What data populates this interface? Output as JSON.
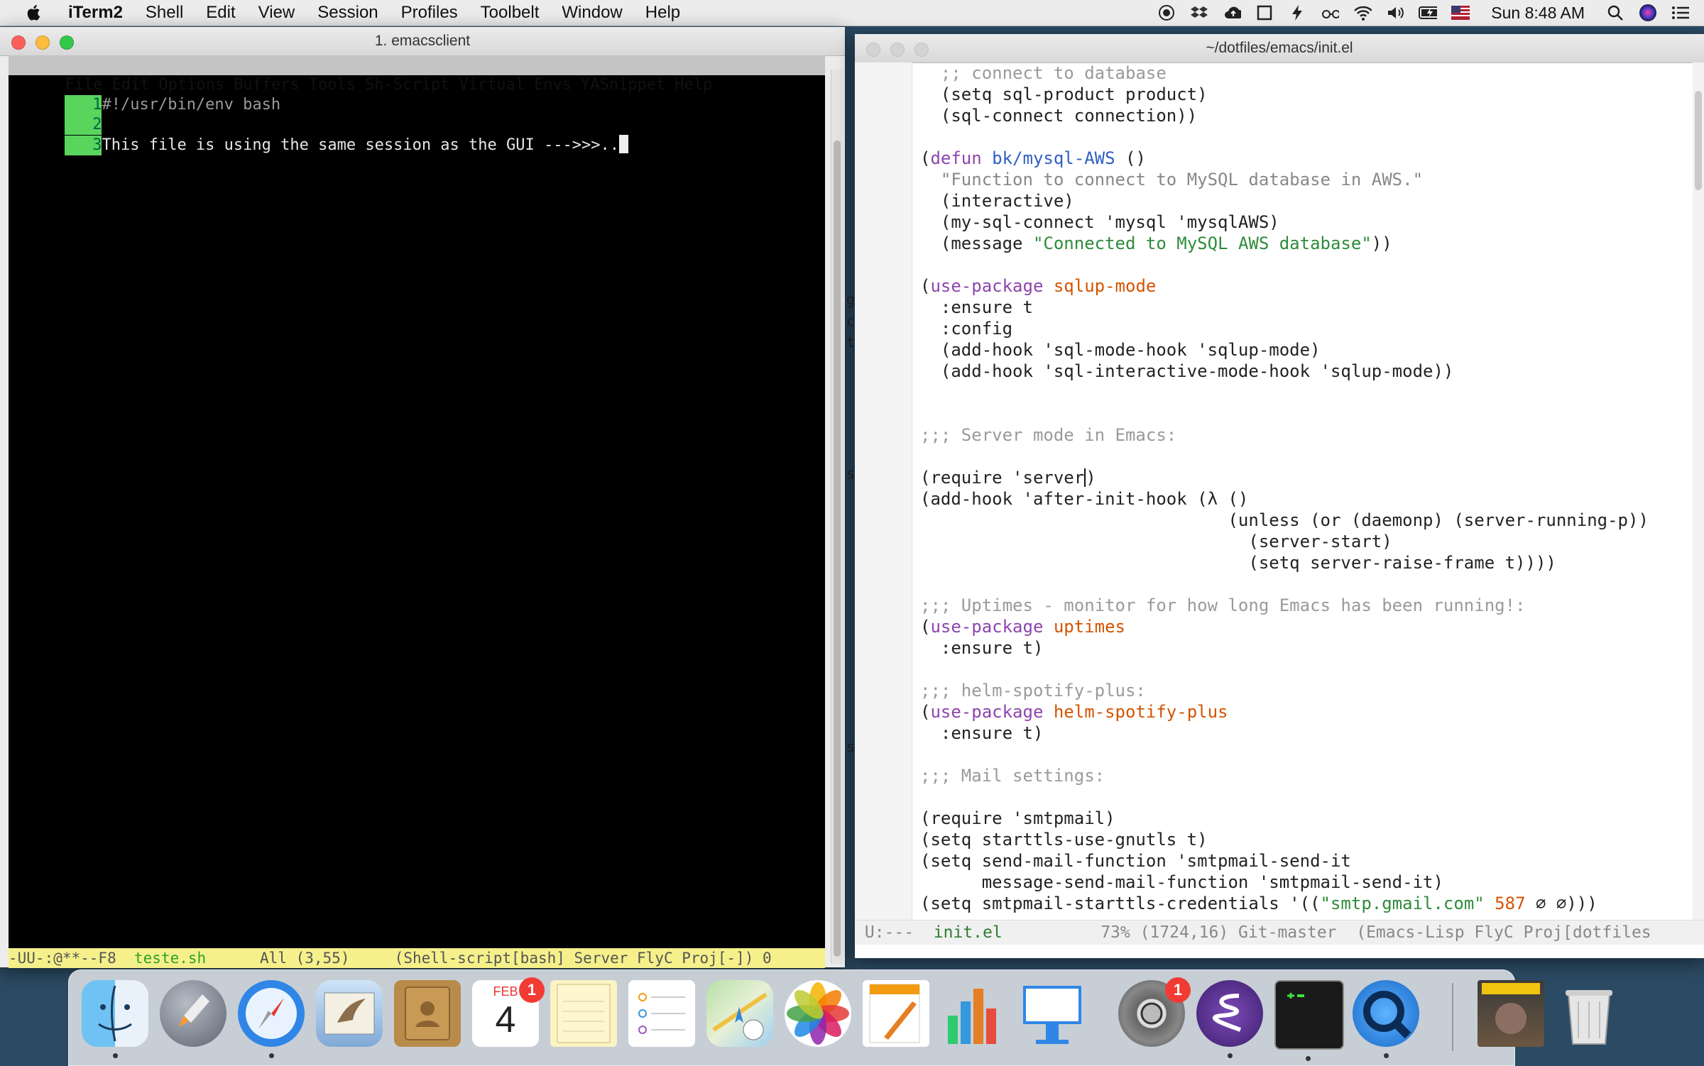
{
  "menubar": {
    "app_name": "iTerm2",
    "items": [
      "Shell",
      "Edit",
      "View",
      "Session",
      "Profiles",
      "Toolbelt",
      "Window",
      "Help"
    ],
    "clock": "Sun 8:48 AM",
    "status_icons": [
      "record-icon",
      "dropbox-icon",
      "cloud-upload-icon",
      "window-icon",
      "bolt-icon",
      "glasses-icon",
      "wifi-icon",
      "volume-icon",
      "battery-icon",
      "flag-us-icon",
      "search-icon",
      "siri-icon",
      "menu-list-icon"
    ]
  },
  "iterm": {
    "title": "1. emacsclient",
    "emacs_menu": [
      "File",
      "Edit",
      "Options",
      "Buffers",
      "Tools",
      "Sh-Script",
      "Virtual",
      "Envs",
      "YASnippet",
      "Help"
    ],
    "lines": [
      {
        "num": "1",
        "text": "#!/usr/bin/env bash"
      },
      {
        "num": "2",
        "text": ""
      },
      {
        "num": "3",
        "text": "This file is using the same session as the GUI --->>>.."
      }
    ],
    "modeline": {
      "prefix": "-UU-:@**--F8  ",
      "buffer": "teste.sh",
      "rest": "      All (3,55)     (Shell-script[bash] Server FlyC Proj[-]) 0"
    }
  },
  "emacs": {
    "title": "~/dotfiles/emacs/init.el",
    "code_lines": [
      {
        "t": ";; connect to database",
        "c": "com",
        "indent": "  "
      },
      {
        "t": "(setq sql-product product)",
        "c": "plain",
        "indent": "  "
      },
      {
        "t": "(sql-connect connection))",
        "c": "plain",
        "indent": "  "
      },
      {
        "t": "",
        "c": "plain",
        "indent": ""
      },
      {
        "t": "(defun bk/mysql-AWS ()",
        "c": "defun",
        "indent": ""
      },
      {
        "t": "\"Function to connect to MySQL database in AWS.\"",
        "c": "doc",
        "indent": "  "
      },
      {
        "t": "(interactive)",
        "c": "plain",
        "indent": "  "
      },
      {
        "t": "(my-sql-connect 'mysql 'mysqlAWS)",
        "c": "plain",
        "indent": "  "
      },
      {
        "t": "(message \"Connected to MySQL AWS database\"))",
        "c": "msg",
        "indent": "  "
      },
      {
        "t": "",
        "c": "plain",
        "indent": ""
      },
      {
        "t": "(use-package sqlup-mode",
        "c": "usepkg",
        "indent": ""
      },
      {
        "t": ":ensure t",
        "c": "plain",
        "indent": "  "
      },
      {
        "t": ":config",
        "c": "plain",
        "indent": "  "
      },
      {
        "t": "(add-hook 'sql-mode-hook 'sqlup-mode)",
        "c": "plain",
        "indent": "  "
      },
      {
        "t": "(add-hook 'sql-interactive-mode-hook 'sqlup-mode))",
        "c": "plain",
        "indent": "  "
      },
      {
        "t": "",
        "c": "plain",
        "indent": ""
      },
      {
        "t": "",
        "c": "plain",
        "indent": ""
      },
      {
        "t": ";;; Server mode in Emacs:",
        "c": "com",
        "indent": ""
      },
      {
        "t": "",
        "c": "plain",
        "indent": ""
      },
      {
        "t": "(require 'server)",
        "c": "caret",
        "indent": ""
      },
      {
        "t": "(add-hook 'after-init-hook (λ ()",
        "c": "plain",
        "indent": ""
      },
      {
        "t": "(unless (or (daemonp) (server-running-p))",
        "c": "plain",
        "indent": "                              "
      },
      {
        "t": "(server-start)",
        "c": "plain",
        "indent": "                                "
      },
      {
        "t": "(setq server-raise-frame t))))",
        "c": "plain",
        "indent": "                                "
      },
      {
        "t": "",
        "c": "plain",
        "indent": ""
      },
      {
        "t": ";;; Uptimes - monitor for how long Emacs has been running!:",
        "c": "com",
        "indent": ""
      },
      {
        "t": "(use-package uptimes",
        "c": "usepkg",
        "indent": ""
      },
      {
        "t": ":ensure t)",
        "c": "plain",
        "indent": "  "
      },
      {
        "t": "",
        "c": "plain",
        "indent": ""
      },
      {
        "t": ";;; helm-spotify-plus:",
        "c": "com",
        "indent": ""
      },
      {
        "t": "(use-package helm-spotify-plus",
        "c": "usepkg",
        "indent": ""
      },
      {
        "t": ":ensure t)",
        "c": "plain",
        "indent": "  "
      },
      {
        "t": "",
        "c": "plain",
        "indent": ""
      },
      {
        "t": ";;; Mail settings:",
        "c": "com",
        "indent": ""
      },
      {
        "t": "",
        "c": "plain",
        "indent": ""
      },
      {
        "t": "(require 'smtpmail)",
        "c": "plain",
        "indent": ""
      },
      {
        "t": "(setq starttls-use-gnutls t)",
        "c": "plain",
        "indent": ""
      },
      {
        "t": "(setq send-mail-function 'smtpmail-send-it",
        "c": "plain",
        "indent": ""
      },
      {
        "t": "message-send-mail-function 'smtpmail-send-it)",
        "c": "plain",
        "indent": "      "
      },
      {
        "t": "(setq smtpmail-starttls-credentials '((\"smtp.gmail.com\" 587 ∅ ∅)))",
        "c": "smtp",
        "indent": ""
      }
    ],
    "modeline": {
      "prefix": " U:---  ",
      "buffer": "init.el",
      "rest": "          73% (1724,16) Git-master  (Emacs-Lisp FlyC Proj[dotfiles"
    }
  },
  "background_strip": [
    "g",
    "c",
    "t",
    "s",
    "s"
  ],
  "dock": {
    "apps": [
      "finder-icon",
      "launchpad-icon",
      "safari-icon",
      "mail-icon",
      "contacts-icon",
      "calendar-icon",
      "notes-icon",
      "reminders-icon",
      "maps-icon",
      "photos-icon",
      "pages-icon",
      "numbers-icon",
      "keynote-icon",
      "system-preferences-icon",
      "emacs-icon",
      "terminal-icon",
      "quicktime-icon",
      "document-thumbnail-icon",
      "trash-icon"
    ],
    "calendar_month": "FEB",
    "calendar_day": "4",
    "calendar_badge": "1",
    "prefs_badge": "1"
  },
  "colors": {
    "accent_green": "#59d45c",
    "modeline_yellow": "#f5f08a",
    "keyword_purple": "#8e44ad",
    "function_blue": "#2f5fc4",
    "string_green": "#2e8b3a",
    "package_orange": "#d35400"
  }
}
